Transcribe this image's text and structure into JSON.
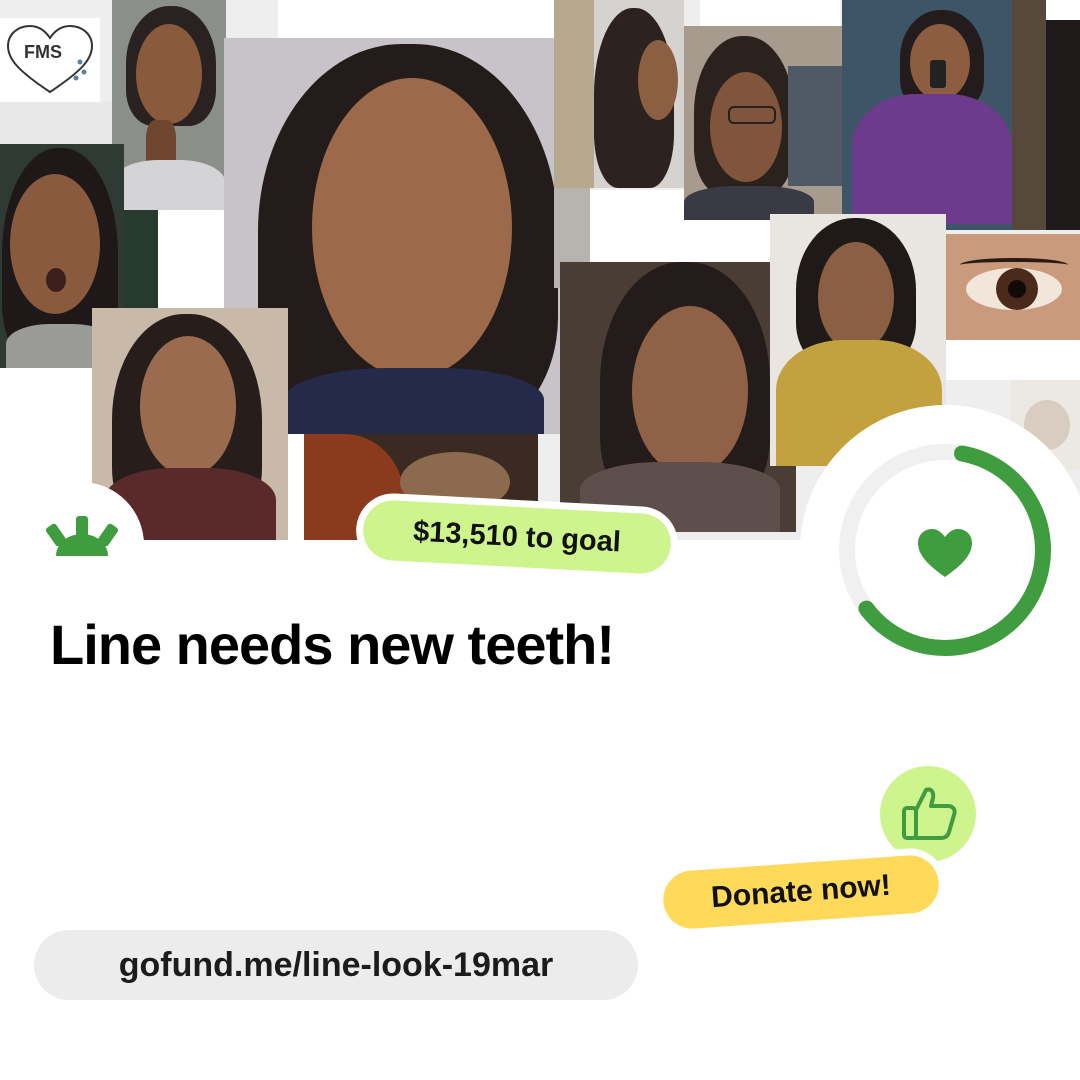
{
  "collage": {
    "sticker_text": "FMS",
    "photos": [
      {
        "name": "photo-fms-sticker"
      },
      {
        "name": "photo-hand-on-chin"
      },
      {
        "name": "photo-closeup-center"
      },
      {
        "name": "photo-profile-window"
      },
      {
        "name": "photo-glasses-bookshelf"
      },
      {
        "name": "photo-mirror-selfie-purple"
      },
      {
        "name": "photo-surprised-face"
      },
      {
        "name": "photo-long-hair-smile"
      },
      {
        "name": "photo-lying-down"
      },
      {
        "name": "photo-smile-right"
      },
      {
        "name": "photo-yellow-sweater"
      },
      {
        "name": "photo-eye-closeup"
      },
      {
        "name": "photo-plush-toy"
      }
    ]
  },
  "fundraiser": {
    "to_goal_label": "$13,510 to goal",
    "title": "Line needs new teeth!",
    "progress_fraction": 0.62,
    "donate_label": "Donate now!",
    "url": "gofund.me/line-look-19mar"
  },
  "icons": {
    "logo": "gofundme-sunrise-icon",
    "progress_center": "heart-icon",
    "thumb": "thumbs-up-icon"
  },
  "colors": {
    "brand_green": "#3f9c3f",
    "goal_pill_bg": "#cdf48d",
    "donate_pill_bg": "#ffd95a",
    "url_pill_bg": "#ececec",
    "progress_track": "#f0f0f0"
  }
}
